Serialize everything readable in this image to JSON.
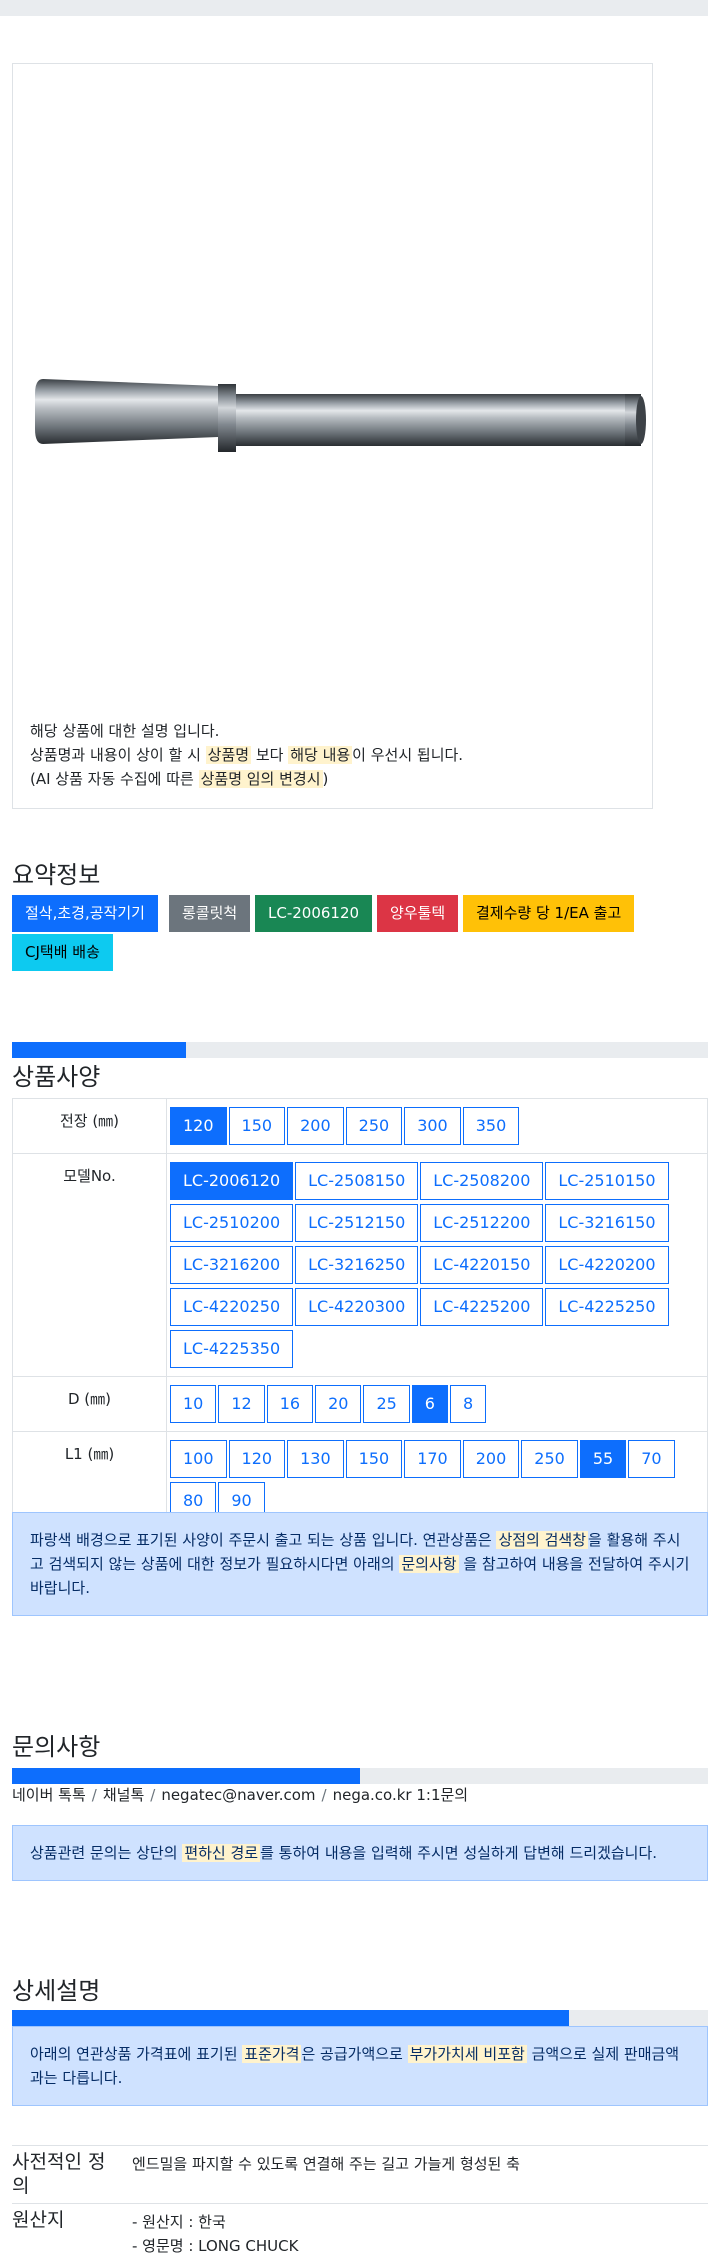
{
  "image_note": {
    "line1": "해당 상품에 대한 설명 입니다.",
    "line2_pre": "상품명과 내용이 상이 할 시 ",
    "line2_h1": "상품명",
    "line2_mid": " 보다 ",
    "line2_h2": "해당 내용",
    "line2_post": "이 우선시 됩니다.",
    "line3_pre": "(AI 상품 자동 수집에 따른 ",
    "line3_h": "상품명 임의 변경시",
    "line3_post": ")"
  },
  "summary": {
    "title": "요약정보",
    "badges": [
      {
        "label": "절삭,초경,공작기기",
        "bg": "#0d6efd",
        "fg": "#ffffff"
      },
      {
        "label": "롱콜릿척",
        "bg": "#6c757d",
        "fg": "#ffffff"
      },
      {
        "label": "LC-2006120",
        "bg": "#198754",
        "fg": "#ffffff"
      },
      {
        "label": "양우툴텍",
        "bg": "#dc3545",
        "fg": "#ffffff"
      },
      {
        "label": "결제수량 당 1/EA 출고",
        "bg": "#ffc107",
        "fg": "#000000"
      },
      {
        "label": "CJ택배 배송",
        "bg": "#0dcaf0",
        "fg": "#000000"
      }
    ]
  },
  "spec": {
    "title": "상품사양",
    "progress": 0.25,
    "rows": [
      {
        "label": "전장 (㎜)",
        "options": [
          "120",
          "150",
          "200",
          "250",
          "300",
          "350"
        ],
        "selected": "120"
      },
      {
        "label": "모델No.",
        "options": [
          "LC-2006120",
          "LC-2508150",
          "LC-2508200",
          "LC-2510150",
          "LC-2510200",
          "LC-2512150",
          "LC-2512200",
          "LC-3216150",
          "LC-3216200",
          "LC-3216250",
          "LC-4220150",
          "LC-4220200",
          "LC-4220250",
          "LC-4220300",
          "LC-4225200",
          "LC-4225250",
          "LC-4225350"
        ],
        "selected": "LC-2006120"
      },
      {
        "label": "D (㎜)",
        "options": [
          "10",
          "12",
          "16",
          "20",
          "25",
          "6",
          "8"
        ],
        "selected": "6"
      },
      {
        "label": "L1 (㎜)",
        "options": [
          "100",
          "120",
          "130",
          "150",
          "170",
          "200",
          "250",
          "55",
          "70",
          "80",
          "90"
        ],
        "selected": "55"
      }
    ],
    "notice_pre": "파랑색 배경으로 표기된 사양이 주문시 출고 되는 상품 입니다. 연관상품은 ",
    "notice_h1": "상점의 검색창",
    "notice_mid": "을 활용해 주시고 검색되지 않는 상품에 대한 정보가 필요하시다면 아래의 ",
    "notice_h2": "문의사항",
    "notice_post": " 을 참고하여 내용을 전달하여 주시기 바랍니다."
  },
  "inquiry": {
    "title": "문의사항",
    "progress": 0.5,
    "links": [
      "네이버 톡톡",
      "채널톡",
      "negatec@naver.com",
      "nega.co.kr 1:1문의"
    ],
    "separator": "/",
    "notice_pre": "상품관련 문의는 상단의 ",
    "notice_h": "편하신 경로",
    "notice_post": "를 통하여 내용을 입력해 주시면 성실하게 답변해 드리겠습니다."
  },
  "detail": {
    "title": "상세설명",
    "progress": 0.8,
    "notice_pre": "아래의 연관상품 가격표에 표기된 ",
    "notice_h1": "표준가격",
    "notice_mid": "은 공급가액으로 ",
    "notice_h2": "부가가치세 비포함",
    "notice_post": " 금액으로 실제 판매금액과는 다릅니다.",
    "defs": [
      {
        "term": "사전적인 정의",
        "desc": [
          "엔드밀을 파지할 수 있도록 연결해 주는 길고 가늘게 형성된 축"
        ]
      },
      {
        "term": "원산지",
        "desc": [
          "- 원산지 : 한국",
          "- 영문명 : LONG CHUCK"
        ]
      }
    ]
  }
}
